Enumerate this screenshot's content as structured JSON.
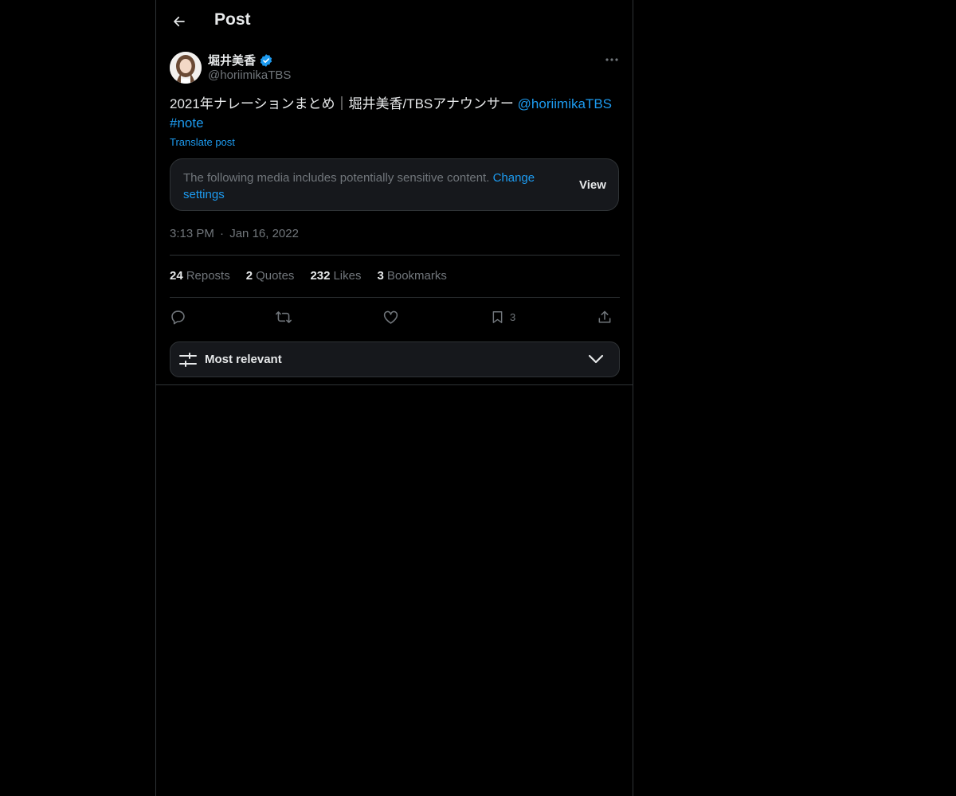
{
  "header": {
    "title": "Post",
    "back_icon": "arrow-left-icon"
  },
  "author": {
    "name": "堀井美香",
    "handle": "@horiimikaTBS",
    "verified_icon": "verified-badge-icon",
    "verified_color": "#1d9bf0"
  },
  "post": {
    "text": "2021年ナレーションまとめ｜堀井美香/TBSアナウンサー ",
    "mention": "@horiimikaTBS",
    "hashtag": "#note",
    "translate_label": "Translate post"
  },
  "sensitive": {
    "message": "The following media includes potentially sensitive content. ",
    "change_settings": "Change settings",
    "view_label": "View"
  },
  "meta": {
    "time": "3:13 PM",
    "separator": "·",
    "date": "Jan 16, 2022"
  },
  "stats": {
    "reposts": {
      "count": "24",
      "label": "Reposts"
    },
    "quotes": {
      "count": "2",
      "label": "Quotes"
    },
    "likes": {
      "count": "232",
      "label": "Likes"
    },
    "bookmarks": {
      "count": "3",
      "label": "Bookmarks"
    }
  },
  "actions": {
    "bookmark_count": "3"
  },
  "sort": {
    "label": "Most relevant"
  },
  "colors": {
    "accent": "#1d9bf0",
    "background": "#000000",
    "muted": "#71767b",
    "border": "#2f3336"
  }
}
